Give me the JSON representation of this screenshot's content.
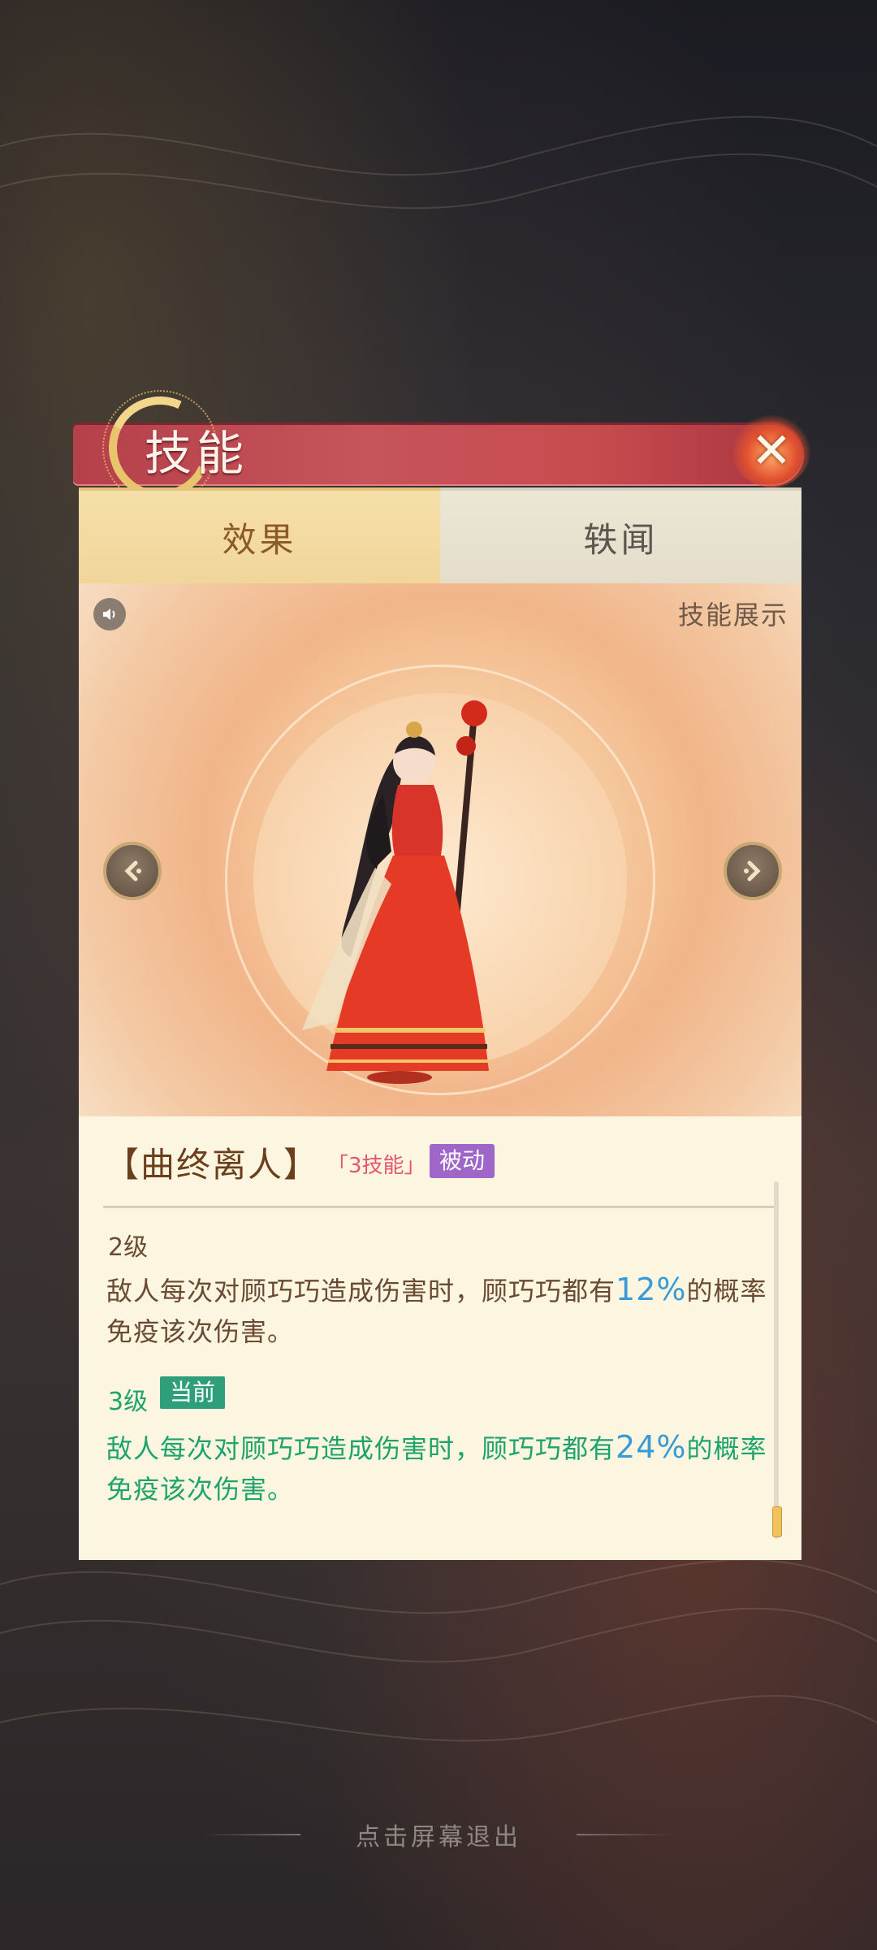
{
  "dialog": {
    "title": "技能",
    "close_icon": "close-icon"
  },
  "tabs": [
    {
      "label": "效果",
      "active": true
    },
    {
      "label": "轶闻",
      "active": false
    }
  ],
  "showcase": {
    "skill_show_label": "技能展示",
    "sound_icon": "speaker-icon",
    "prev_icon": "chevron-left-icon",
    "next_icon": "chevron-right-icon"
  },
  "skill": {
    "name": "【曲终离人】",
    "slot_tag": "「3技能」",
    "type_badge": "被动",
    "levels": [
      {
        "level_label": "2级",
        "desc_prefix": "敌人每次对顾巧巧造成伤害时，顾巧巧都有",
        "chance": "12%",
        "desc_suffix": "的概率免疫该次伤害。"
      },
      {
        "level_label": "3级",
        "current_badge": "当前",
        "desc_prefix": "敌人每次对顾巧巧造成伤害时，顾巧巧都有",
        "chance": "24%",
        "desc_suffix": "的概率免疫该次伤害。"
      }
    ]
  },
  "footer": {
    "exit_hint": "点击屏幕退出"
  },
  "colors": {
    "title_bar": "#c6545a",
    "current_level_text": "#1fa36d",
    "chance_highlight": "#3a9ad6",
    "type_badge": "#9f66c9"
  }
}
